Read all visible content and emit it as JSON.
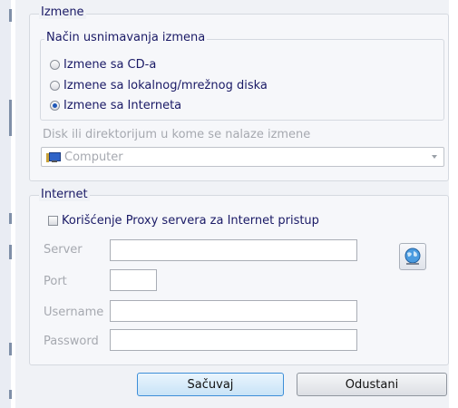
{
  "changes_group": {
    "title": "Izmene",
    "mode_group": {
      "title": "Način usnimavanja izmena",
      "options": [
        {
          "label": "Izmene sa CD-a",
          "checked": false
        },
        {
          "label": "Izmene sa lokalnog/mrežnog diska",
          "checked": false
        },
        {
          "label": "Izmene sa Interneta",
          "checked": true
        }
      ]
    },
    "disk_label": "Disk ili direktorijum u kome se nalaze izmene",
    "disk_combo": {
      "value": "Computer",
      "icon": "computer-icon"
    }
  },
  "internet_group": {
    "title": "Internet",
    "proxy_checkbox": {
      "label": "Korišćenje Proxy servera za Internet pristup",
      "checked": false
    },
    "fields": {
      "server_label": "Server",
      "port_label": "Port",
      "username_label": "Username",
      "password_label": "Password",
      "server_value": "",
      "port_value": "",
      "username_value": "",
      "password_value": ""
    },
    "globe_button_icon": "globe-icon"
  },
  "buttons": {
    "save_label": "Sačuvaj",
    "cancel_label": "Odustani"
  },
  "colors": {
    "accent": "#1f57b8",
    "text": "#1a1a66",
    "disabled_text": "#a6a9b0"
  }
}
